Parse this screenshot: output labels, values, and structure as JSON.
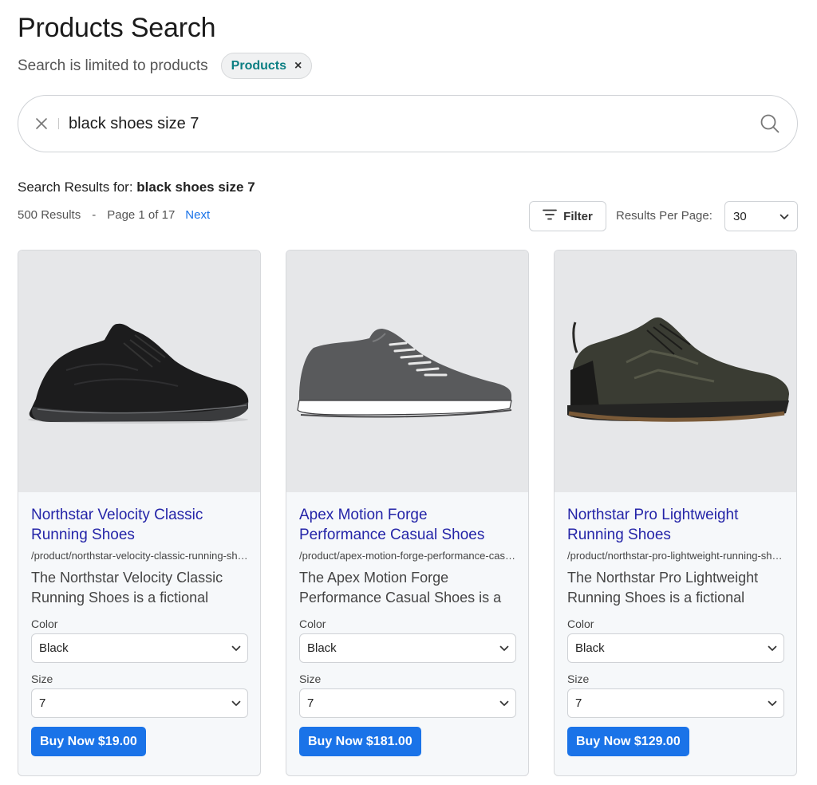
{
  "page": {
    "title": "Products Search"
  },
  "scope": {
    "text": "Search is limited to products",
    "chip_label": "Products",
    "chip_close": "×"
  },
  "search": {
    "query": "black shoes size 7"
  },
  "results": {
    "label": "Search Results for:",
    "query": "black shoes size 7",
    "count_text": "500 Results",
    "dash": "-",
    "page_text": "Page 1 of 17",
    "next_label": "Next"
  },
  "controls": {
    "filter_label": "Filter",
    "rpp_label": "Results Per Page:",
    "rpp_value": "30"
  },
  "colors": {
    "accent": "#1a73e8",
    "title_link": "#2424a8",
    "chip_text": "#0c7f83"
  },
  "products": [
    {
      "title": "Northstar Velocity Classic Running Shoes",
      "url": "/product/northstar-velocity-classic-running-shoes",
      "description": "The Northstar Velocity Classic Running Shoes is a fictional",
      "color_label": "Color",
      "color_value": "Black",
      "size_label": "Size",
      "size_value": "7",
      "buy_label": "Buy Now $19.00"
    },
    {
      "title": "Apex Motion Forge Performance Casual Shoes",
      "url": "/product/apex-motion-forge-performance-casual-shoes",
      "description": "The Apex Motion Forge Performance Casual Shoes is a",
      "color_label": "Color",
      "color_value": "Black",
      "size_label": "Size",
      "size_value": "7",
      "buy_label": "Buy Now $181.00"
    },
    {
      "title": "Northstar Pro Lightweight Running Shoes",
      "url": "/product/northstar-pro-lightweight-running-shoes",
      "description": "The Northstar Pro Lightweight Running Shoes is a fictional",
      "color_label": "Color",
      "color_value": "Black",
      "size_label": "Size",
      "size_value": "7",
      "buy_label": "Buy Now $129.00"
    }
  ]
}
